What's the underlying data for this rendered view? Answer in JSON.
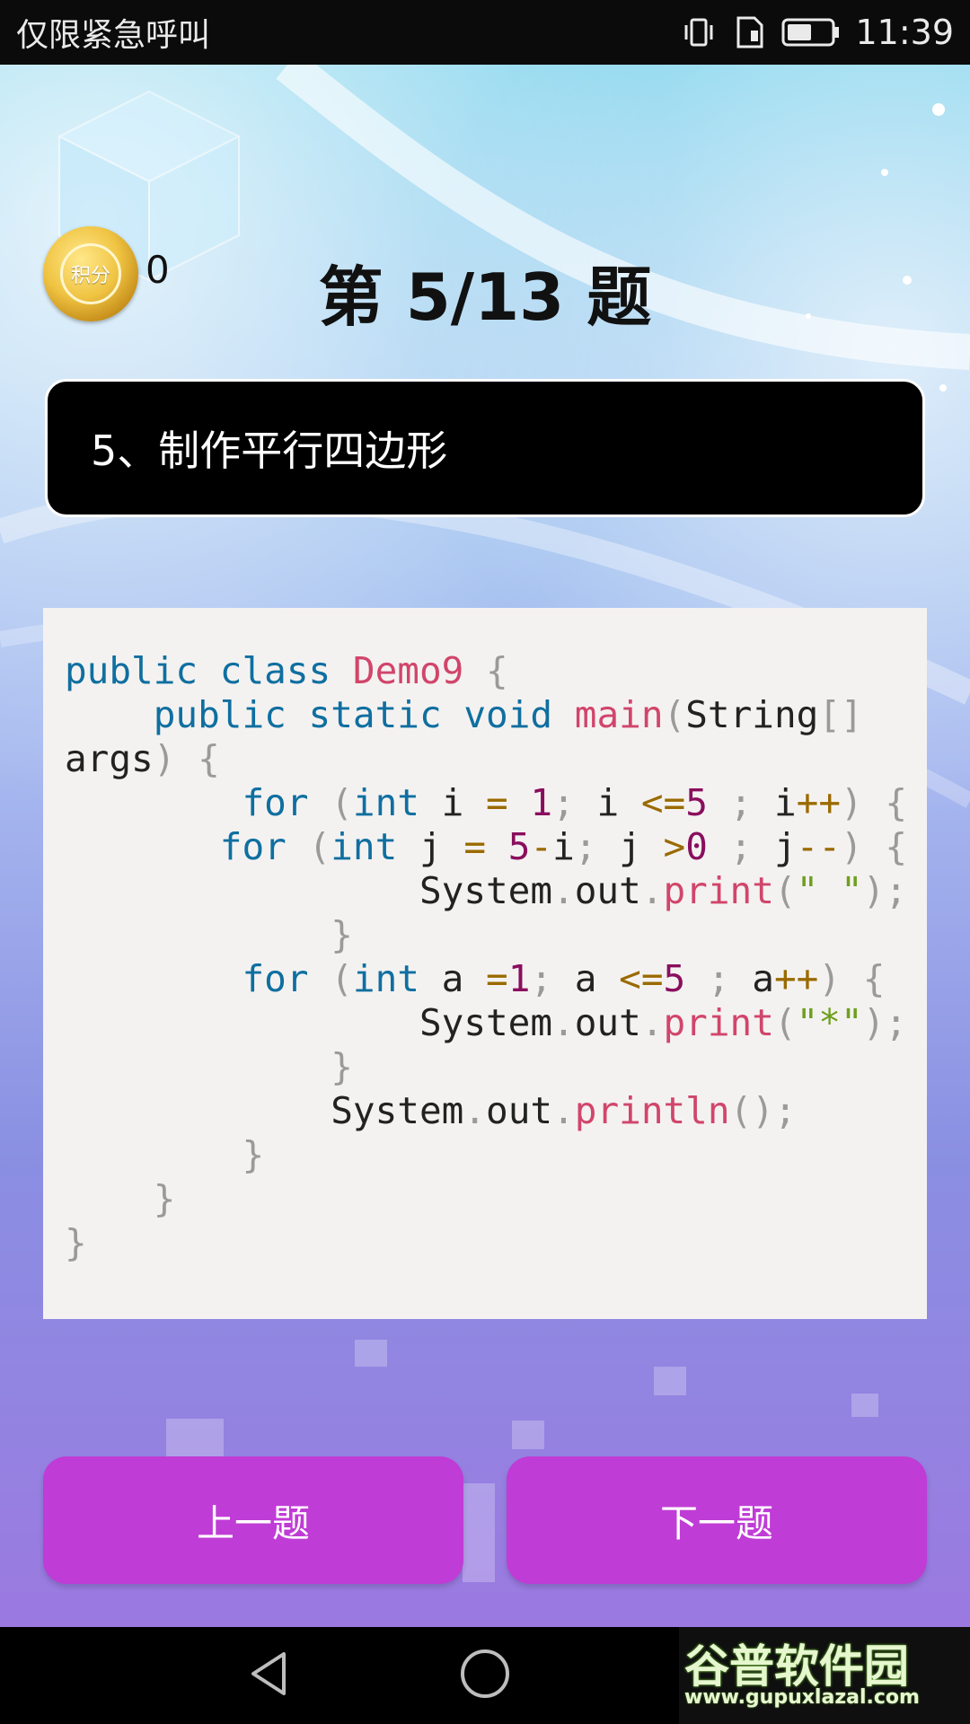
{
  "status_bar": {
    "carrier": "仅限紧急呼叫",
    "time": "11:39",
    "icons": [
      "vibrate-icon",
      "sim-icon",
      "battery-icon"
    ]
  },
  "header": {
    "coin_label": "积分",
    "score": "0",
    "question_title": "第 5/13 题"
  },
  "question": {
    "text": "5、制作平行四边形"
  },
  "code_lines": [
    "public class Demo9 {",
    "    public static void main(String[]",
    "args) {",
    "        for (int i = 1; i <=5 ; i++) {",
    "       for (int j = 5-i; j >0 ; j--) {",
    "                System.out.print(\" \");",
    "            }",
    "        for (int a =1; a <=5 ; a++) {",
    "                System.out.print(\"*\");",
    "            }",
    "            System.out.println();",
    "        }",
    "    }",
    "}"
  ],
  "buttons": {
    "prev": "上一题",
    "next": "下一题"
  },
  "navbar": {
    "icons": [
      "back-icon",
      "home-icon"
    ]
  },
  "watermark": {
    "logo": "谷普软件园",
    "url": "www.gupuxlazal.com"
  },
  "colors": {
    "button": "#c03cd6",
    "question_box": "#000000",
    "code_bg": "#f4f2f1"
  }
}
